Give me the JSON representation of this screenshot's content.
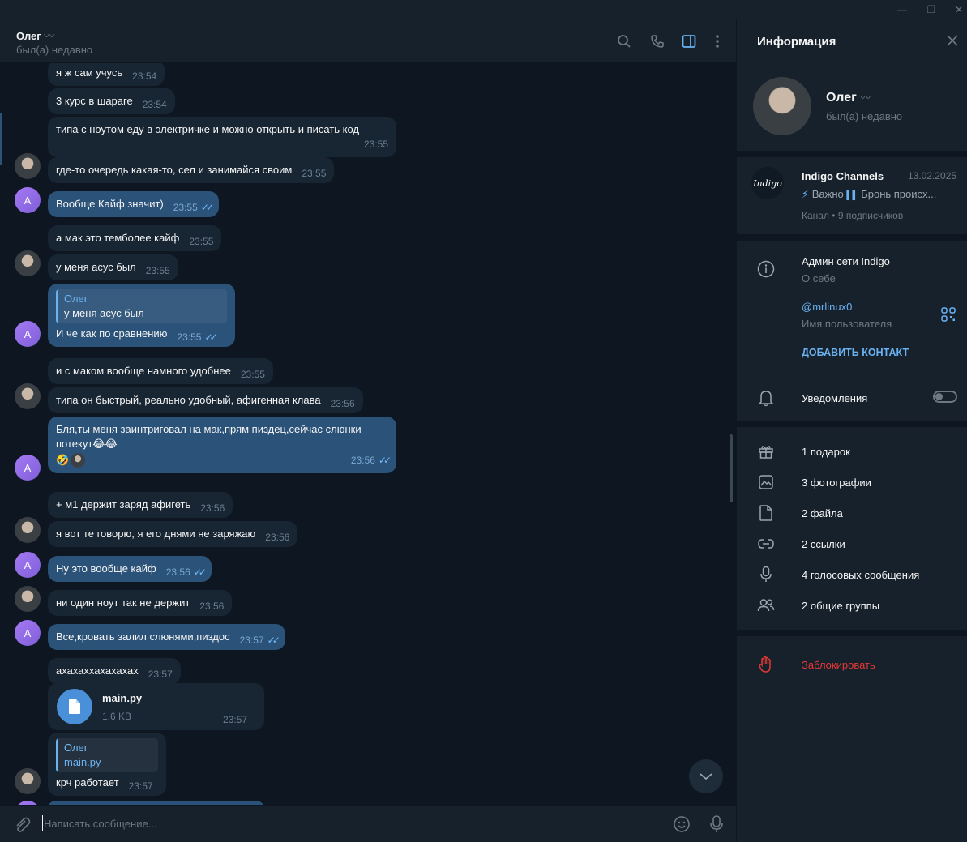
{
  "window": {
    "minimize": "—",
    "restore": "❐",
    "close": "✕"
  },
  "chat": {
    "name": "Олег",
    "status": "был(а) недавно",
    "messages": [
      {
        "text": "я ж сам учусь",
        "time": "23:54"
      },
      {
        "text": "3 курс в шараге",
        "time": "23:54"
      },
      {
        "text": "типа с ноутом еду в электричке и можно открыть и писать код",
        "time": "23:55"
      },
      {
        "text": "где-то очередь какая-то, сел и занимайся своим",
        "time": "23:55"
      },
      {
        "text": "Вообще Кайф значит)",
        "time": "23:55"
      },
      {
        "text": "а мак это темболее кайф",
        "time": "23:55"
      },
      {
        "text": "у меня асус был",
        "time": "23:55"
      },
      {
        "reply_name": "Олег",
        "reply_text": "у меня асус был",
        "text": "И че как по сравнению",
        "time": "23:55"
      },
      {
        "text": "и с маком вообще намного удобнее",
        "time": "23:55"
      },
      {
        "text": "типа он быстрый, реально удобный, афигенная клава",
        "time": "23:56"
      },
      {
        "text_line1": "Бля,ты меня заинтриговал на мак,прям пиздец,сейчас слюнки",
        "text_line2": "потекут😂😂",
        "reaction": "🤣",
        "time": "23:56"
      },
      {
        "text": "+ м1 держит заряд афигеть",
        "time": "23:56"
      },
      {
        "text": "я вот те говорю, я его днями не заряжаю",
        "time": "23:56"
      },
      {
        "text": "Ну это вообще кайф",
        "time": "23:56"
      },
      {
        "text": "ни один ноут так не держит",
        "time": "23:56"
      },
      {
        "text": "Все,кровать залил слюнями,пиздос",
        "time": "23:57"
      },
      {
        "text": "ахахаххахахахах",
        "time": "23:57"
      },
      {
        "file_name": "main.py",
        "file_size": "1.6 KB",
        "time": "23:57"
      },
      {
        "reply_name": "Олег",
        "reply_text": "main.py",
        "text": "крч работает",
        "time": "23:57"
      }
    ],
    "avatar_letter": "A",
    "composer_placeholder": "Написать сообщение..."
  },
  "info": {
    "title": "Информация",
    "name": "Олег",
    "status": "был(а) недавно",
    "channel": {
      "name": "Indigo Channels",
      "date": "13.02.2025",
      "logo": "Indigo",
      "preview_a": "Важно",
      "preview_b": "Бронь происх...",
      "meta": "Канал • 9 подписчиков"
    },
    "bio": "Админ сети Indigo",
    "bio_label": "О себе",
    "username": "@mrlinux0",
    "username_label": "Имя пользователя",
    "add_contact": "ДОБАВИТЬ КОНТАКТ",
    "notifications": "Уведомления",
    "media": [
      "1 подарок",
      "3 фотографии",
      "2 файла",
      "2 ссылки",
      "4 голосовых сообщения",
      "2 общие группы"
    ],
    "block": "Заблокировать"
  },
  "colors": {
    "accent": "#6ab2f2",
    "outgoing": "#2b5278",
    "incoming": "#182533",
    "danger": "#e53935"
  }
}
